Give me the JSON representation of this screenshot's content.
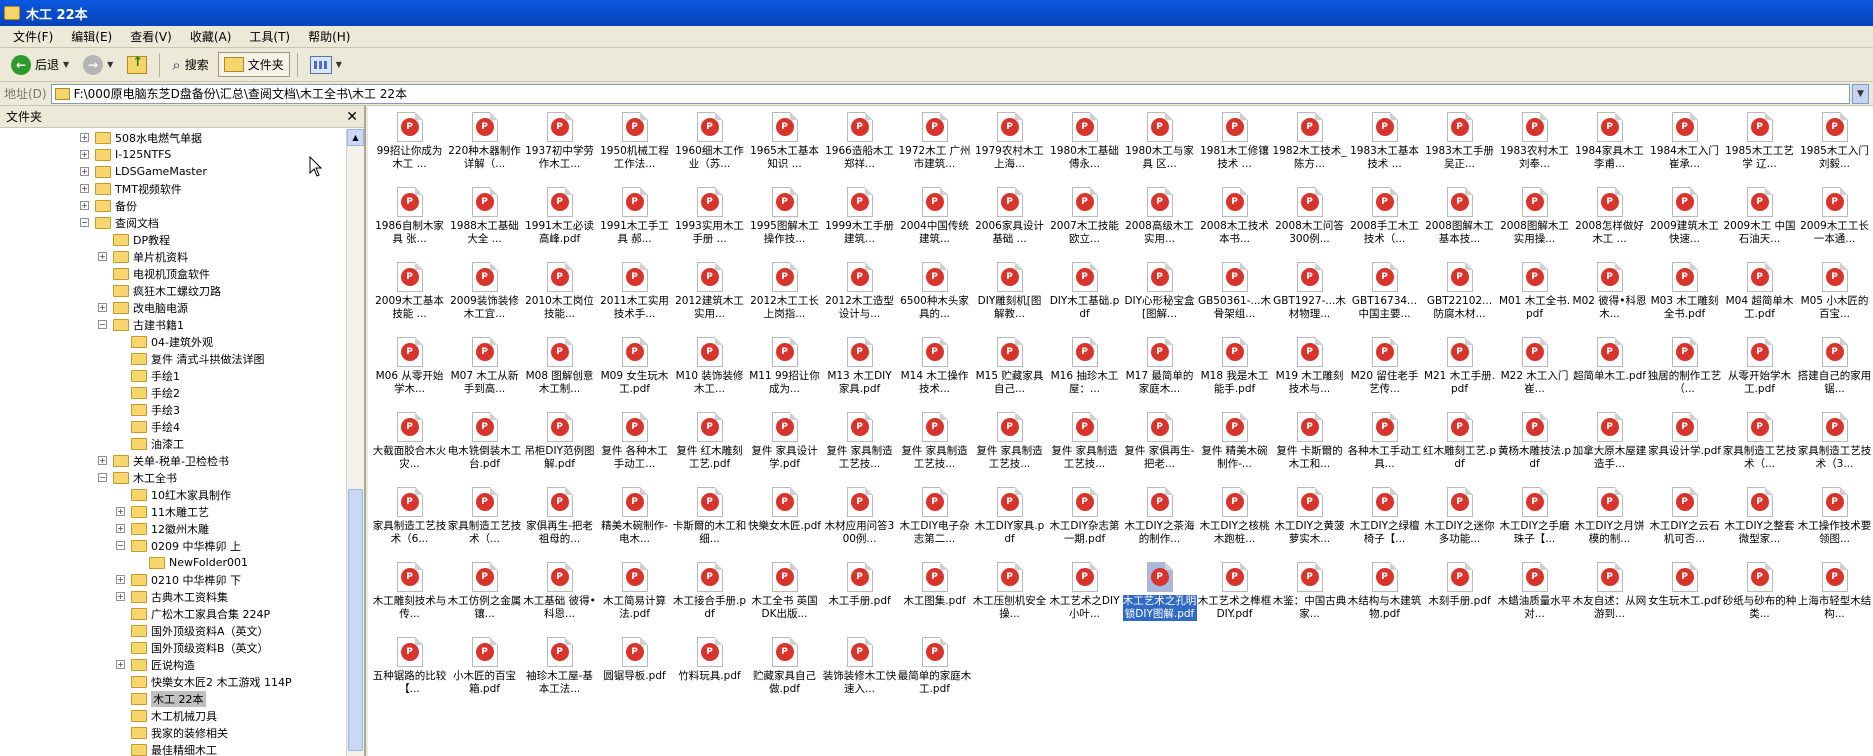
{
  "window": {
    "title": "木工 22本"
  },
  "menu": [
    "文件(F)",
    "编辑(E)",
    "查看(V)",
    "收藏(A)",
    "工具(T)",
    "帮助(H)"
  ],
  "toolbar": {
    "back": "后退",
    "search": "搜索",
    "folders": "文件夹"
  },
  "address": {
    "label": "地址(D)",
    "path": "F:\\000原电脑东芝D盘备份\\汇总\\查阅文档\\木工全书\\木工 22本"
  },
  "left_pane": {
    "title": "文件夹",
    "tree": [
      {
        "label": "508水电燃气单据",
        "indent": 0,
        "exp": "+"
      },
      {
        "label": "I-125NTFS",
        "indent": 0,
        "exp": "+"
      },
      {
        "label": "LDSGameMaster",
        "indent": 0,
        "exp": "+"
      },
      {
        "label": "TMT视频软件",
        "indent": 0,
        "exp": "+"
      },
      {
        "label": "备份",
        "indent": 0,
        "exp": "+"
      },
      {
        "label": "查阅文档",
        "indent": 0,
        "exp": "-"
      },
      {
        "label": "DP教程",
        "indent": 1,
        "exp": ""
      },
      {
        "label": "单片机资料",
        "indent": 1,
        "exp": "+"
      },
      {
        "label": "电视机顶盒软件",
        "indent": 1,
        "exp": ""
      },
      {
        "label": "疯狂木工螺纹刀路",
        "indent": 1,
        "exp": ""
      },
      {
        "label": "改电脑电源",
        "indent": 1,
        "exp": "+"
      },
      {
        "label": "古建书籍1",
        "indent": 1,
        "exp": "-"
      },
      {
        "label": "04-建筑外观",
        "indent": 2,
        "exp": ""
      },
      {
        "label": "复件 清式斗拱做法详图",
        "indent": 2,
        "exp": ""
      },
      {
        "label": "手绘1",
        "indent": 2,
        "exp": ""
      },
      {
        "label": "手绘2",
        "indent": 2,
        "exp": ""
      },
      {
        "label": "手绘3",
        "indent": 2,
        "exp": ""
      },
      {
        "label": "手绘4",
        "indent": 2,
        "exp": ""
      },
      {
        "label": "油漆工",
        "indent": 2,
        "exp": ""
      },
      {
        "label": "关单-税单-卫检检书",
        "indent": 1,
        "exp": "+"
      },
      {
        "label": "木工全书",
        "indent": 1,
        "exp": "-"
      },
      {
        "label": "10红木家具制作",
        "indent": 2,
        "exp": ""
      },
      {
        "label": "11木雕工艺",
        "indent": 2,
        "exp": "+"
      },
      {
        "label": "12徽州木雕",
        "indent": 2,
        "exp": "+"
      },
      {
        "label": "0209 中华榫卯 上",
        "indent": 2,
        "exp": "-"
      },
      {
        "label": "NewFolder001",
        "indent": 3,
        "exp": ""
      },
      {
        "label": "0210 中华榫卯 下",
        "indent": 2,
        "exp": "+"
      },
      {
        "label": "古典木工资料集",
        "indent": 2,
        "exp": "+"
      },
      {
        "label": "广松木工家具合集 224P",
        "indent": 2,
        "exp": ""
      },
      {
        "label": "国外顶级资料A（英文）",
        "indent": 2,
        "exp": ""
      },
      {
        "label": "国外顶级资料B（英文）",
        "indent": 2,
        "exp": ""
      },
      {
        "label": "匠说构造",
        "indent": 2,
        "exp": "+"
      },
      {
        "label": "快樂女木匠2 木工游戏 114P",
        "indent": 2,
        "exp": ""
      },
      {
        "label": "木工 22本",
        "indent": 2,
        "exp": "",
        "selected": true
      },
      {
        "label": "木工机械刀具",
        "indent": 2,
        "exp": ""
      },
      {
        "label": "我家的装修相关",
        "indent": 2,
        "exp": ""
      },
      {
        "label": "最佳精细木工",
        "indent": 2,
        "exp": ""
      }
    ]
  },
  "icons": {
    "app": "folder-icon",
    "back": "back-arrow-icon",
    "forward": "forward-arrow-icon",
    "up": "folder-up-icon",
    "search": "search-icon",
    "folders": "folders-icon",
    "views": "views-icon",
    "pdf": "pdf-file-icon",
    "close": "close-icon"
  },
  "colors": {
    "titlebar": "#0a58e0",
    "selection": "#316ac5",
    "pdf_badge": "#d9342b"
  },
  "files": [
    "99招让你成为木工 ...",
    "220种木器制作详解（...",
    "1937初中学劳作木工...",
    "1950机械工程工作法...",
    "1960细木工作业（苏...",
    "1965木工基本知识 ...",
    "1966造船木工 郑祥...",
    "1972木工 广州市建筑...",
    "1979农村木工 上海...",
    "1980木工基础 傅永...",
    "1980木工与家具 区...",
    "1981木工修镶技术 ...",
    "1982木工技术_陈方...",
    "1983木工基本技术 ...",
    "1983木工手册 吴正...",
    "1983农村木工 刘奉...",
    "1984家具木工 李甫...",
    "1984木工入门 崔承...",
    "1985木工工艺学 辽...",
    "1985木工入门 刘毅...",
    "1986自制木家具 张...",
    "1988木工基础大全 ...",
    "1991木工必读 高峰.pdf",
    "1991木工手工具 郝...",
    "1993实用木工手册 ...",
    "1995图解木工操作技...",
    "1999木工手册 建筑...",
    "2004中国传统建筑...",
    "2006家具设计基础 ...",
    "2007木工技能 欧立...",
    "2008高级木工实用...",
    "2008木工技术 本书...",
    "2008木工问答300例...",
    "2008手工木工技术（...",
    "2008图解木工基本技...",
    "2008图解木工实用操...",
    "2008怎样做好木工 ...",
    "2009建筑木工快速...",
    "2009木工 中国石油天...",
    "2009木工工长一本通...",
    "2009木工基本技能 ...",
    "2009装饰装修木工宜...",
    "2010木工岗位技能...",
    "2011木工实用技术手...",
    "2012建筑木工实用...",
    "2012木工工长上岗指...",
    "2012木工造型设计与...",
    "6500种木头家具的...",
    "DIY雕刻机[图解教...",
    "DIY木工基础.pdf",
    "DIY心形秘宝盒[图解...",
    "GB50361-...木骨架组...",
    "GBT1927-...木材物理...",
    "GBT16734...中国主要...",
    "GBT22102...防腐木材...",
    "M01 木工全书.pdf",
    "M02 彼得•科恩木...",
    "M03 木工雕刻全书.pdf",
    "M04 超简单木工.pdf",
    "M05 小木匠的百宝...",
    "M06 从零开始学木...",
    "M07 木工从新手到高...",
    "M08 图解创意木工制...",
    "M09 女生玩木工.pdf",
    "M10 装饰装修木工...",
    "M11 99招让你成为...",
    "M13 木工DIY家具.pdf",
    "M14 木工操作技术...",
    "M15 贮藏家具自己...",
    "M16 抽珍木工屋：...",
    "M17 最简单的家庭木...",
    "M18 我是木工能手.pdf",
    "M19 木工雕刻技术与...",
    "M20 留住老手艺传...",
    "M21 木工手册.pdf",
    "M22 木工入门 崔...",
    "超简单木工.pdf",
    "独居的制作工艺（...",
    "从零开始学木工.pdf",
    "搭建自己的家用锯...",
    "大截面胶合木火灾...",
    "电木铣倒装木工台.pdf",
    "吊柜DIY范例图解.pdf",
    "复件 各种木工手动工...",
    "复件 红木雕刻工艺.pdf",
    "复件 家具设计学.pdf",
    "复件 家具制造工艺技...",
    "复件 家具制造工艺技...",
    "复件 家具制造工艺技...",
    "复件 家具制造工艺技...",
    "复件 家俱再生-把老...",
    "复件 精美木碗制作-...",
    "复件 卡斯爾的木工和...",
    "各种木工手动工具...",
    "红木雕刻工艺.pdf",
    "黄杨木雕技法.pdf",
    "加拿大原木屋建造手...",
    "家具设计学.pdf",
    "家具制造工艺技术（...",
    "家具制造工艺技术（3...",
    "家具制造工艺技术（6...",
    "家具制造工艺技术（...",
    "家俱再生-把老祖母的...",
    "精美木碗制作-电木...",
    "卡斯爾的木工和细...",
    "快樂女木匠.pdf",
    "木材应用问答300例...",
    "木工DIY电子杂志第二...",
    "木工DIY家具.pdf",
    "木工DIY杂志第一期.pdf",
    "木工DIY之茶海的制作...",
    "木工DIY之核桃木跑桩...",
    "木工DIY之黄菠萝实木...",
    "木工DIY之绿檀椅子【...",
    "木工DIY之迷你多功能...",
    "木工DIY之手磨珠子【...",
    "木工DIY之月饼模的制...",
    "木工DIY之云石机可否...",
    "木工DIY之整套微型家...",
    "木工操作技术要领图...",
    "木工雕刻技术与传...",
    "木工仿例之金属镶...",
    "木工基础 彼得•科恩...",
    "木工简易计算法.pdf",
    "木工接合手册.pdf",
    "木工全书 英国DK出版...",
    "木工手册.pdf",
    "木工图集.pdf",
    "木工压刨机安全操...",
    "木工艺术之DIY小叶...",
    "木工艺术之孔明锁DIY图解.pdf",
    "木工艺术之榫框DIY.pdf",
    "木鉴：中国古典家...",
    "木结构与木建筑物.pdf",
    "木刻手册.pdf",
    "木蜡油质量水平对...",
    "木友自述：从网游到...",
    "女生玩木工.pdf",
    "砂纸与砂布的种类...",
    "上海市轻型木结构...",
    "五种锯路的比较【...",
    "小木匠的百宝箱.pdf",
    "袖珍木工屋-基本工法...",
    "圆锯导板.pdf",
    "竹料玩具.pdf",
    "贮藏家具自己做.pdf",
    "装饰装修木工快速入...",
    "最简单的家庭木工.pdf"
  ],
  "selected_file_index": 130
}
